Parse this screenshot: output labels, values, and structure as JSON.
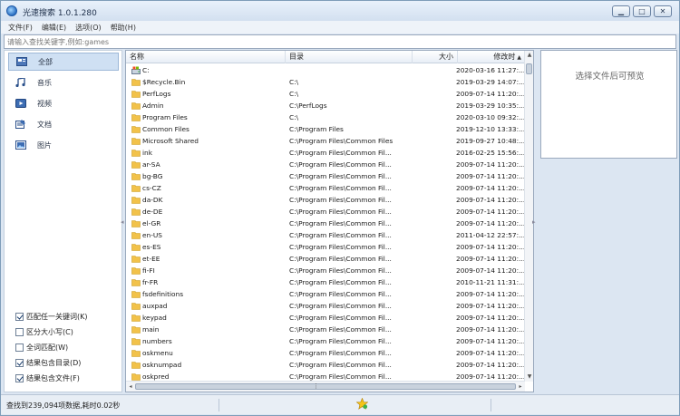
{
  "window": {
    "title": "光速搜索 1.0.1.280",
    "controls": [
      "minimize-icon",
      "maximize-icon",
      "close-icon"
    ]
  },
  "menubar": {
    "items": [
      "文件(F)",
      "编辑(E)",
      "选项(O)",
      "帮助(H)"
    ]
  },
  "search": {
    "placeholder": "请输入查找关键字,例如:games",
    "value": ""
  },
  "categories": [
    {
      "label": "全部",
      "icon": "all-icon",
      "selected": true
    },
    {
      "label": "音乐",
      "icon": "music-icon",
      "selected": false
    },
    {
      "label": "视频",
      "icon": "video-icon",
      "selected": false
    },
    {
      "label": "文档",
      "icon": "document-icon",
      "selected": false
    },
    {
      "label": "图片",
      "icon": "image-icon",
      "selected": false
    }
  ],
  "options": [
    {
      "label": "匹配任一关键词(K)",
      "checked": true
    },
    {
      "label": "区分大小写(C)",
      "checked": false
    },
    {
      "label": "全词匹配(W)",
      "checked": false
    },
    {
      "label": "结果包含目录(D)",
      "checked": true
    },
    {
      "label": "结果包含文件(F)",
      "checked": true
    }
  ],
  "list": {
    "columns": {
      "name": "名称",
      "dir": "目录",
      "size": "大小",
      "modified": "修改时"
    },
    "rows": [
      {
        "icon": "drive-icon",
        "name": "C:",
        "dir": "",
        "size": "",
        "modified": "2020-03-16 11:27:..."
      },
      {
        "icon": "folder-icon",
        "name": "$Recycle.Bin",
        "dir": "C:\\",
        "size": "",
        "modified": "2019-03-29 14:07:..."
      },
      {
        "icon": "folder-icon",
        "name": "PerfLogs",
        "dir": "C:\\",
        "size": "",
        "modified": "2009-07-14 11:20:..."
      },
      {
        "icon": "folder-icon",
        "name": "Admin",
        "dir": "C:\\PerfLogs",
        "size": "",
        "modified": "2019-03-29 10:35:..."
      },
      {
        "icon": "folder-icon",
        "name": "Program Files",
        "dir": "C:\\",
        "size": "",
        "modified": "2020-03-10 09:32:..."
      },
      {
        "icon": "folder-icon",
        "name": "Common Files",
        "dir": "C:\\Program Files",
        "size": "",
        "modified": "2019-12-10 13:33:..."
      },
      {
        "icon": "folder-icon",
        "name": "Microsoft Shared",
        "dir": "C:\\Program Files\\Common Files",
        "size": "",
        "modified": "2019-09-27 10:48:..."
      },
      {
        "icon": "folder-icon",
        "name": "ink",
        "dir": "C:\\Program Files\\Common Fil...",
        "size": "",
        "modified": "2016-02-25 15:56:..."
      },
      {
        "icon": "folder-icon",
        "name": "ar-SA",
        "dir": "C:\\Program Files\\Common Fil...",
        "size": "",
        "modified": "2009-07-14 11:20:..."
      },
      {
        "icon": "folder-icon",
        "name": "bg-BG",
        "dir": "C:\\Program Files\\Common Fil...",
        "size": "",
        "modified": "2009-07-14 11:20:..."
      },
      {
        "icon": "folder-icon",
        "name": "cs-CZ",
        "dir": "C:\\Program Files\\Common Fil...",
        "size": "",
        "modified": "2009-07-14 11:20:..."
      },
      {
        "icon": "folder-icon",
        "name": "da-DK",
        "dir": "C:\\Program Files\\Common Fil...",
        "size": "",
        "modified": "2009-07-14 11:20:..."
      },
      {
        "icon": "folder-icon",
        "name": "de-DE",
        "dir": "C:\\Program Files\\Common Fil...",
        "size": "",
        "modified": "2009-07-14 11:20:..."
      },
      {
        "icon": "folder-icon",
        "name": "el-GR",
        "dir": "C:\\Program Files\\Common Fil...",
        "size": "",
        "modified": "2009-07-14 11:20:..."
      },
      {
        "icon": "folder-icon",
        "name": "en-US",
        "dir": "C:\\Program Files\\Common Fil...",
        "size": "",
        "modified": "2011-04-12 22:57:..."
      },
      {
        "icon": "folder-icon",
        "name": "es-ES",
        "dir": "C:\\Program Files\\Common Fil...",
        "size": "",
        "modified": "2009-07-14 11:20:..."
      },
      {
        "icon": "folder-icon",
        "name": "et-EE",
        "dir": "C:\\Program Files\\Common Fil...",
        "size": "",
        "modified": "2009-07-14 11:20:..."
      },
      {
        "icon": "folder-icon",
        "name": "fi-FI",
        "dir": "C:\\Program Files\\Common Fil...",
        "size": "",
        "modified": "2009-07-14 11:20:..."
      },
      {
        "icon": "folder-icon",
        "name": "fr-FR",
        "dir": "C:\\Program Files\\Common Fil...",
        "size": "",
        "modified": "2010-11-21 11:31:..."
      },
      {
        "icon": "folder-icon",
        "name": "fsdefinitions",
        "dir": "C:\\Program Files\\Common Fil...",
        "size": "",
        "modified": "2009-07-14 11:20:..."
      },
      {
        "icon": "folder-icon",
        "name": "auxpad",
        "dir": "C:\\Program Files\\Common Fil...",
        "size": "",
        "modified": "2009-07-14 11:20:..."
      },
      {
        "icon": "folder-icon",
        "name": "keypad",
        "dir": "C:\\Program Files\\Common Fil...",
        "size": "",
        "modified": "2009-07-14 11:20:..."
      },
      {
        "icon": "folder-icon",
        "name": "main",
        "dir": "C:\\Program Files\\Common Fil...",
        "size": "",
        "modified": "2009-07-14 11:20:..."
      },
      {
        "icon": "folder-icon",
        "name": "numbers",
        "dir": "C:\\Program Files\\Common Fil...",
        "size": "",
        "modified": "2009-07-14 11:20:..."
      },
      {
        "icon": "folder-icon",
        "name": "oskmenu",
        "dir": "C:\\Program Files\\Common Fil...",
        "size": "",
        "modified": "2009-07-14 11:20:..."
      },
      {
        "icon": "folder-icon",
        "name": "osknumpad",
        "dir": "C:\\Program Files\\Common Fil...",
        "size": "",
        "modified": "2009-07-14 11:20:..."
      },
      {
        "icon": "folder-icon",
        "name": "oskpred",
        "dir": "C:\\Program Files\\Common Fil...",
        "size": "",
        "modified": "2009-07-14 11:20:..."
      }
    ]
  },
  "preview": {
    "placeholder": "选择文件后可预览"
  },
  "status": {
    "text": "查找到239,094项数据,耗时0.02秒",
    "icon": "star-icon"
  },
  "colors": {
    "folder": "#f2c24a",
    "selected_bg": "#cfe0f3",
    "chrome": "#dce6f2"
  }
}
